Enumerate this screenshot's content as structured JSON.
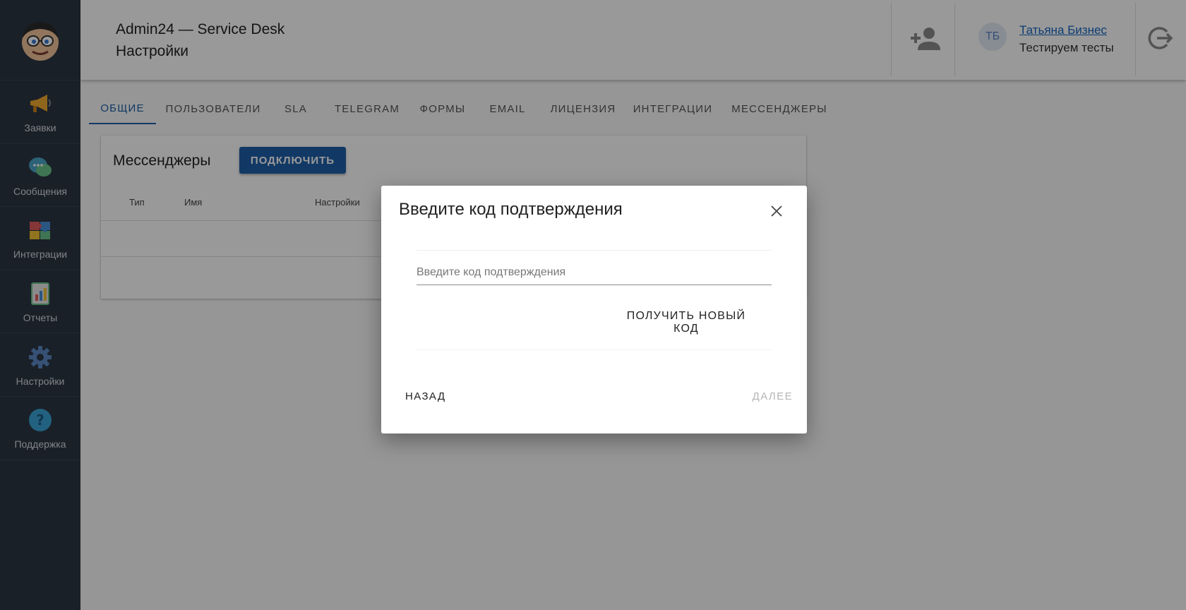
{
  "header": {
    "app_title": "Admin24 — Service Desk",
    "page_title": "Настройки",
    "user_initials": "ТБ",
    "user_name": "Татьяна Бизнес",
    "user_company": "Тестируем тесты"
  },
  "sidebar": {
    "items": [
      {
        "label": "Заявки",
        "icon": "megaphone-icon"
      },
      {
        "label": "Сообщения",
        "icon": "chat-bubbles-icon"
      },
      {
        "label": "Интеграции",
        "icon": "puzzle-icon"
      },
      {
        "label": "Отчеты",
        "icon": "report-icon"
      },
      {
        "label": "Настройки",
        "icon": "gear-icon"
      },
      {
        "label": "Поддержка",
        "icon": "question-icon"
      }
    ]
  },
  "tabs": [
    {
      "label": "ОБЩИЕ",
      "active": true
    },
    {
      "label": "ПОЛЬЗОВАТЕЛИ"
    },
    {
      "label": "SLA"
    },
    {
      "label": "TELEGRAM"
    },
    {
      "label": "ФОРМЫ"
    },
    {
      "label": "EMAIL"
    },
    {
      "label": "ЛИЦЕНЗИЯ"
    },
    {
      "label": "ИНТЕГРАЦИИ"
    },
    {
      "label": "МЕССЕНДЖЕРЫ"
    }
  ],
  "card": {
    "title": "Мессенджеры",
    "connect_label": "ПОДКЛЮЧИТЬ",
    "columns": [
      "Тип",
      "Имя",
      "Настройки"
    ]
  },
  "dialog": {
    "title": "Введите код подтверждения",
    "input_placeholder": "Введите код подтверждения",
    "input_value": "",
    "new_code_label": "ПОЛУЧИТЬ НОВЫЙ КОД",
    "back_label": "НАЗАД",
    "next_label": "ДАЛЕЕ"
  },
  "colors": {
    "sidebar_bg": "#2c3644",
    "primary": "#1f5fa8",
    "link": "#1565c0",
    "disabled_text": "#b5b5b5"
  }
}
